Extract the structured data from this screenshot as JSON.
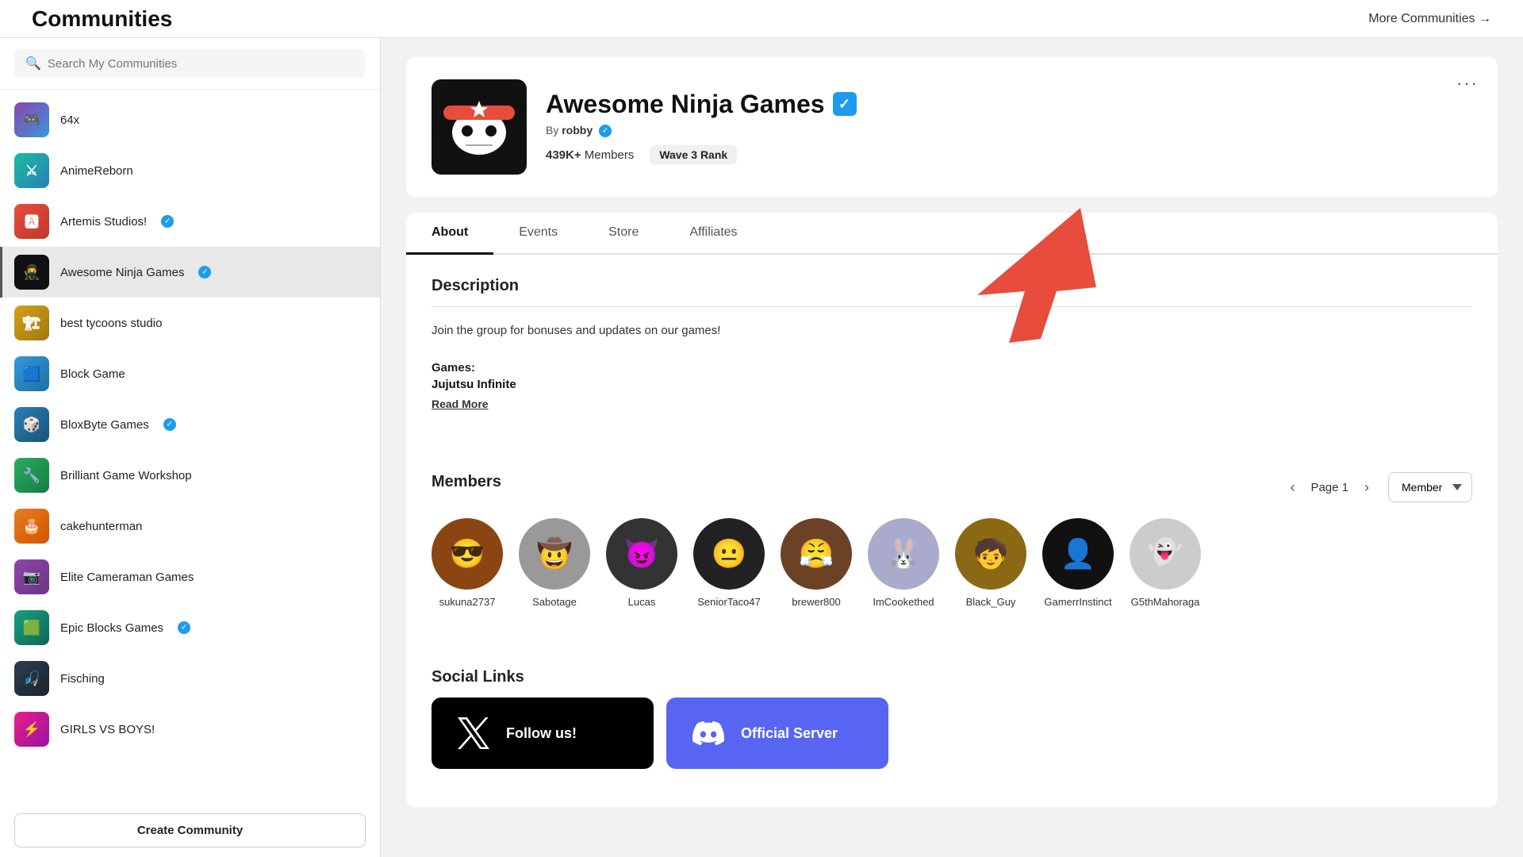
{
  "page": {
    "title": "Communities",
    "more_communities": "More Communities →"
  },
  "sidebar": {
    "search_placeholder": "Search My Communities",
    "communities": [
      {
        "id": "64x",
        "name": "64x",
        "verified": false,
        "active": false,
        "color": "av-64x",
        "emoji": "🎮"
      },
      {
        "id": "animereborn",
        "name": "AnimeReborn",
        "verified": false,
        "active": false,
        "color": "av-anime",
        "emoji": "⚔"
      },
      {
        "id": "artemis",
        "name": "Artemis Studios!",
        "verified": true,
        "active": false,
        "color": "av-artemis",
        "emoji": "🅰"
      },
      {
        "id": "awesomeninja",
        "name": "Awesome Ninja Games",
        "verified": true,
        "active": true,
        "color": "av-ninja",
        "emoji": "🥷"
      },
      {
        "id": "besttycoons",
        "name": "best tycoons studio",
        "verified": false,
        "active": false,
        "color": "av-tycoon",
        "emoji": "🏗"
      },
      {
        "id": "blockgame",
        "name": "Block Game",
        "verified": false,
        "active": false,
        "color": "av-blockgame",
        "emoji": "🟦"
      },
      {
        "id": "bloxbyte",
        "name": "BloxByte Games",
        "verified": true,
        "active": false,
        "color": "av-bloxbyte",
        "emoji": "🎲"
      },
      {
        "id": "brilliant",
        "name": "Brilliant Game Workshop",
        "verified": false,
        "active": false,
        "color": "av-brilliant",
        "emoji": "🔧"
      },
      {
        "id": "cake",
        "name": "cakehunterman",
        "verified": false,
        "active": false,
        "color": "av-cake",
        "emoji": "🎂"
      },
      {
        "id": "elite",
        "name": "Elite Cameraman Games",
        "verified": false,
        "active": false,
        "color": "av-elite",
        "emoji": "📷"
      },
      {
        "id": "epic",
        "name": "Epic Blocks Games",
        "verified": true,
        "active": false,
        "color": "av-epic",
        "emoji": "🟩"
      },
      {
        "id": "fisching",
        "name": "Fisching",
        "verified": false,
        "active": false,
        "color": "av-fisching",
        "emoji": "🎣"
      },
      {
        "id": "girlsvboys",
        "name": "GIRLS VS BOYS!",
        "verified": false,
        "active": false,
        "color": "av-girlsvboys",
        "emoji": "⚡"
      }
    ],
    "create_community": "Create Community"
  },
  "community": {
    "name": "Awesome Ninja Games",
    "verified": true,
    "by_label": "By",
    "author": "robby",
    "author_verified": true,
    "members_count": "439K+",
    "members_label": "Members",
    "rank_value": "Wave 3",
    "rank_label": "Rank",
    "tabs": [
      {
        "id": "about",
        "label": "About",
        "active": true
      },
      {
        "id": "events",
        "label": "Events",
        "active": false
      },
      {
        "id": "store",
        "label": "Store",
        "active": false
      },
      {
        "id": "affiliates",
        "label": "Affiliates",
        "active": false
      }
    ],
    "description_title": "Description",
    "description_text": "Join the group for bonuses and updates on our games!",
    "games_label": "Games:",
    "games_list": "Jujutsu Infinite",
    "read_more": "Read More",
    "members_title": "Members",
    "page_label": "Page 1",
    "member_filter_default": "Member",
    "members": [
      {
        "id": "sukuna",
        "name": "sukuna2737",
        "color": "#8B4513"
      },
      {
        "id": "sabotage",
        "name": "Sabotage",
        "color": "#999"
      },
      {
        "id": "lucas",
        "name": "Lucas",
        "color": "#333"
      },
      {
        "id": "seniortaco",
        "name": "SeniorTaco47",
        "color": "#222"
      },
      {
        "id": "brewer",
        "name": "brewer800",
        "color": "#6B4226"
      },
      {
        "id": "imcookethed",
        "name": "ImCookethed",
        "color": "#aac"
      },
      {
        "id": "blackguy",
        "name": "Black_Guy",
        "color": "#8B6914"
      },
      {
        "id": "gamerr",
        "name": "GamerrInstinct",
        "color": "#111"
      },
      {
        "id": "g5th",
        "name": "G5thMahoraga",
        "color": "#ccc"
      }
    ],
    "social_title": "Social Links",
    "social_links": [
      {
        "id": "twitter",
        "label": "Follow us!",
        "type": "x",
        "color": "#000"
      },
      {
        "id": "discord",
        "label": "Official Server",
        "type": "discord",
        "color": "#5865f2"
      }
    ],
    "more_options": "···"
  }
}
